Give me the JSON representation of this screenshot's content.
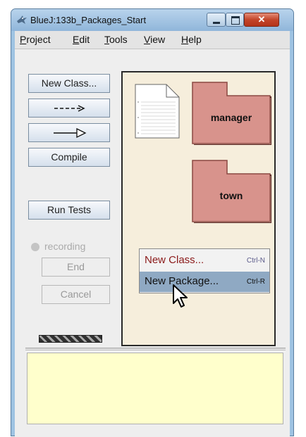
{
  "window": {
    "title": "BlueJ:133b_Packages_Start"
  },
  "title_buttons": [
    "minimize",
    "maximize",
    "close"
  ],
  "menubar": [
    {
      "mnemonic": "P",
      "rest": "roject"
    },
    {
      "mnemonic": "E",
      "rest": "dit"
    },
    {
      "mnemonic": "T",
      "rest": "ools"
    },
    {
      "mnemonic": "V",
      "rest": "iew"
    },
    {
      "mnemonic": "H",
      "rest": "elp"
    }
  ],
  "toolbar": {
    "new_class": "New Class...",
    "uses_arrow_label": "--->",
    "inherits_arrow_label": "—▷",
    "compile": "Compile",
    "run_tests": "Run Tests",
    "recording": "recording",
    "end": "End",
    "cancel": "Cancel"
  },
  "packages": [
    {
      "name": "manager"
    },
    {
      "name": "town"
    }
  ],
  "context_menu": {
    "items": [
      {
        "label": "New Class...",
        "shortcut": "Ctrl-N",
        "highlighted": false
      },
      {
        "label": "New Package...",
        "shortcut": "Ctrl-R",
        "highlighted": true
      }
    ]
  },
  "colors": {
    "package_fill": "#d8938c",
    "package_border": "#8a4842",
    "panel_bg": "#f6eedc",
    "terminal_bg": "#ffffcc",
    "menu_highlight": "#8fa9c3",
    "context_text": "#8b1a1a"
  },
  "icons": {
    "app": "bluej-bird-icon",
    "readme": "readme-document-icon",
    "cursor": "mouse-pointer-icon"
  }
}
